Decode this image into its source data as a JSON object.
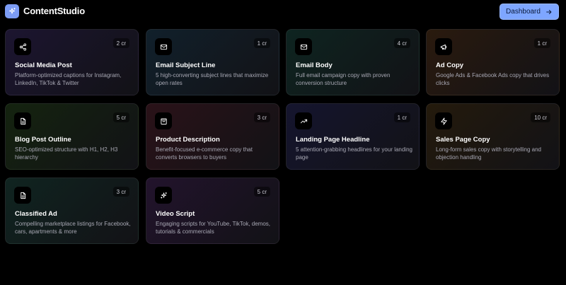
{
  "app": {
    "brand": "ContentStudio",
    "logo_icon": "sparkles-icon"
  },
  "header": {
    "dashboard_label": "Dashboard",
    "dashboard_icon": "arrow-right-icon"
  },
  "colors": {
    "accent": "#7ea6ff",
    "logo": "#7c9cf5",
    "background": "#000000"
  },
  "cards": [
    {
      "title": "Social Media Post",
      "credits": "2 cr",
      "description": "Platform-optimized captions for Instagram, LinkedIn, TikTok & Twitter",
      "icon": "share-icon",
      "tint": "#1c1530"
    },
    {
      "title": "Email Subject Line",
      "credits": "1 cr",
      "description": "5 high-converting subject lines that maximize open rates",
      "icon": "mail-icon",
      "tint": "#11202b"
    },
    {
      "title": "Email Body",
      "credits": "4 cr",
      "description": "Full email campaign copy with proven conversion structure",
      "icon": "mail-icon",
      "tint": "#0e2420"
    },
    {
      "title": "Ad Copy",
      "credits": "1 cr",
      "description": "Google Ads & Facebook Ads copy that drives clicks",
      "icon": "megaphone-icon",
      "tint": "#2a1a0e"
    },
    {
      "title": "Blog Post Outline",
      "credits": "5 cr",
      "description": "SEO-optimized structure with H1, H2, H3 hierarchy",
      "icon": "document-icon",
      "tint": "#14230f"
    },
    {
      "title": "Product Description",
      "credits": "3 cr",
      "description": "Benefit-focused e-commerce copy that converts browsers to buyers",
      "icon": "shopping-bag-icon",
      "tint": "#2a1218"
    },
    {
      "title": "Landing Page Headline",
      "credits": "1 cr",
      "description": "5 attention-grabbing headlines for your landing page",
      "icon": "trending-up-icon",
      "tint": "#15152e"
    },
    {
      "title": "Sales Page Copy",
      "credits": "10 cr",
      "description": "Long-form sales copy with storytelling and objection handling",
      "icon": "lightning-icon",
      "tint": "#241a0c"
    },
    {
      "title": "Classified Ad",
      "credits": "3 cr",
      "description": "Compelling marketplace listings for Facebook, cars, apartments & more",
      "icon": "document-icon",
      "tint": "#102420"
    },
    {
      "title": "Video Script",
      "credits": "5 cr",
      "description": "Engaging scripts for YouTube, TikTok, demos, tutorials & commercials",
      "icon": "sparkles-icon",
      "tint": "#22132c"
    }
  ]
}
